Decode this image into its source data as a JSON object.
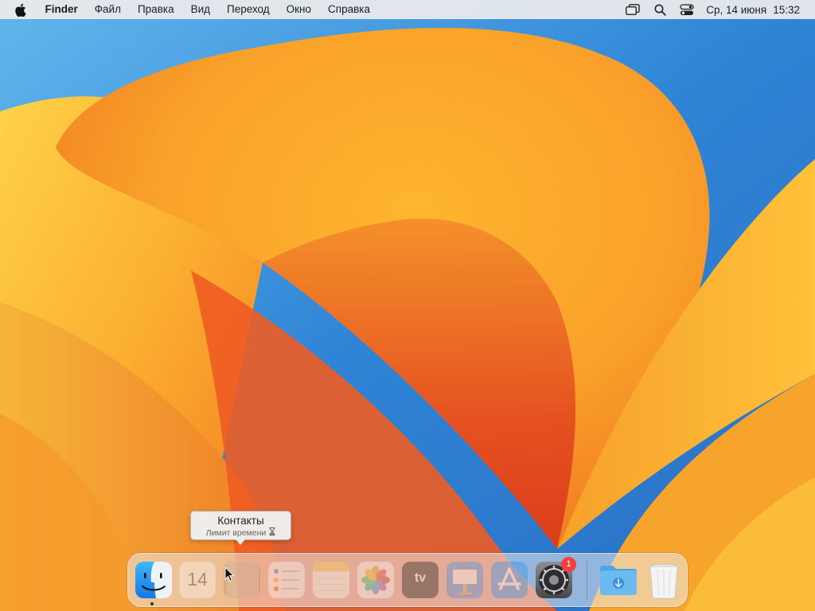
{
  "menubar": {
    "app_name": "Finder",
    "items": [
      "Файл",
      "Правка",
      "Вид",
      "Переход",
      "Окно",
      "Справка"
    ],
    "status_icons": [
      "screen-mirroring-icon",
      "spotlight-search-icon",
      "control-center-icon"
    ],
    "date": "Ср, 14 июня",
    "time": "15:32"
  },
  "tooltip": {
    "title": "Контакты",
    "subtitle": "Лимит времени"
  },
  "dock": {
    "apps": [
      {
        "name": "Finder",
        "icon": "finder-icon",
        "running": true,
        "dimmed": false
      },
      {
        "name": "Календарь",
        "icon": "calendar-icon",
        "day": "14",
        "dimmed": true
      },
      {
        "name": "Контакты",
        "icon": "contacts-icon",
        "dimmed": true
      },
      {
        "name": "Напоминания",
        "icon": "reminders-icon",
        "dimmed": true
      },
      {
        "name": "Заметки",
        "icon": "notes-icon",
        "dimmed": true
      },
      {
        "name": "Фото",
        "icon": "photos-icon",
        "dimmed": true
      },
      {
        "name": "TV",
        "icon": "apple-tv-icon",
        "label": "tv",
        "dimmed": true
      },
      {
        "name": "Keynote",
        "icon": "keynote-icon",
        "dimmed": true
      },
      {
        "name": "App Store",
        "icon": "app-store-icon",
        "dimmed": true
      },
      {
        "name": "Системные настройки",
        "icon": "system-settings-icon",
        "badge": "1",
        "dimmed": false
      },
      {
        "name": "Загрузки",
        "icon": "downloads-folder-icon",
        "dimmed": false
      },
      {
        "name": "Корзина",
        "icon": "trash-icon",
        "dimmed": false
      }
    ]
  },
  "colors": {
    "wallpaper_blue": "#3b8fd9",
    "wallpaper_orange": "#f6a12a",
    "badge_red": "#f0413a"
  }
}
